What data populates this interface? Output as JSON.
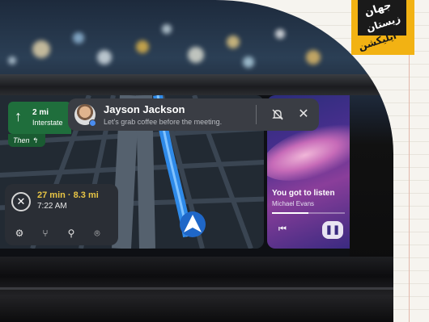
{
  "navigation": {
    "distance": "2 mi",
    "road": "Interstate",
    "then_label": "Then ↰"
  },
  "notification": {
    "name": "Jayson Jackson",
    "message": "Let's grab coffee before the meeting."
  },
  "trip": {
    "eta": "27 min · 8.3 mi",
    "arrival_time": "7:22 AM"
  },
  "media": {
    "title": "You got to listen",
    "artist": "Michael Evans",
    "progress": 0.5
  },
  "logo": {
    "line1": "جهان",
    "line2": "زيستان",
    "line3": "ایلیکشن"
  },
  "colors": {
    "nav_green": "#1f6e3c",
    "eta_yellow": "#e8c545",
    "logo_yellow": "#f2b213"
  }
}
